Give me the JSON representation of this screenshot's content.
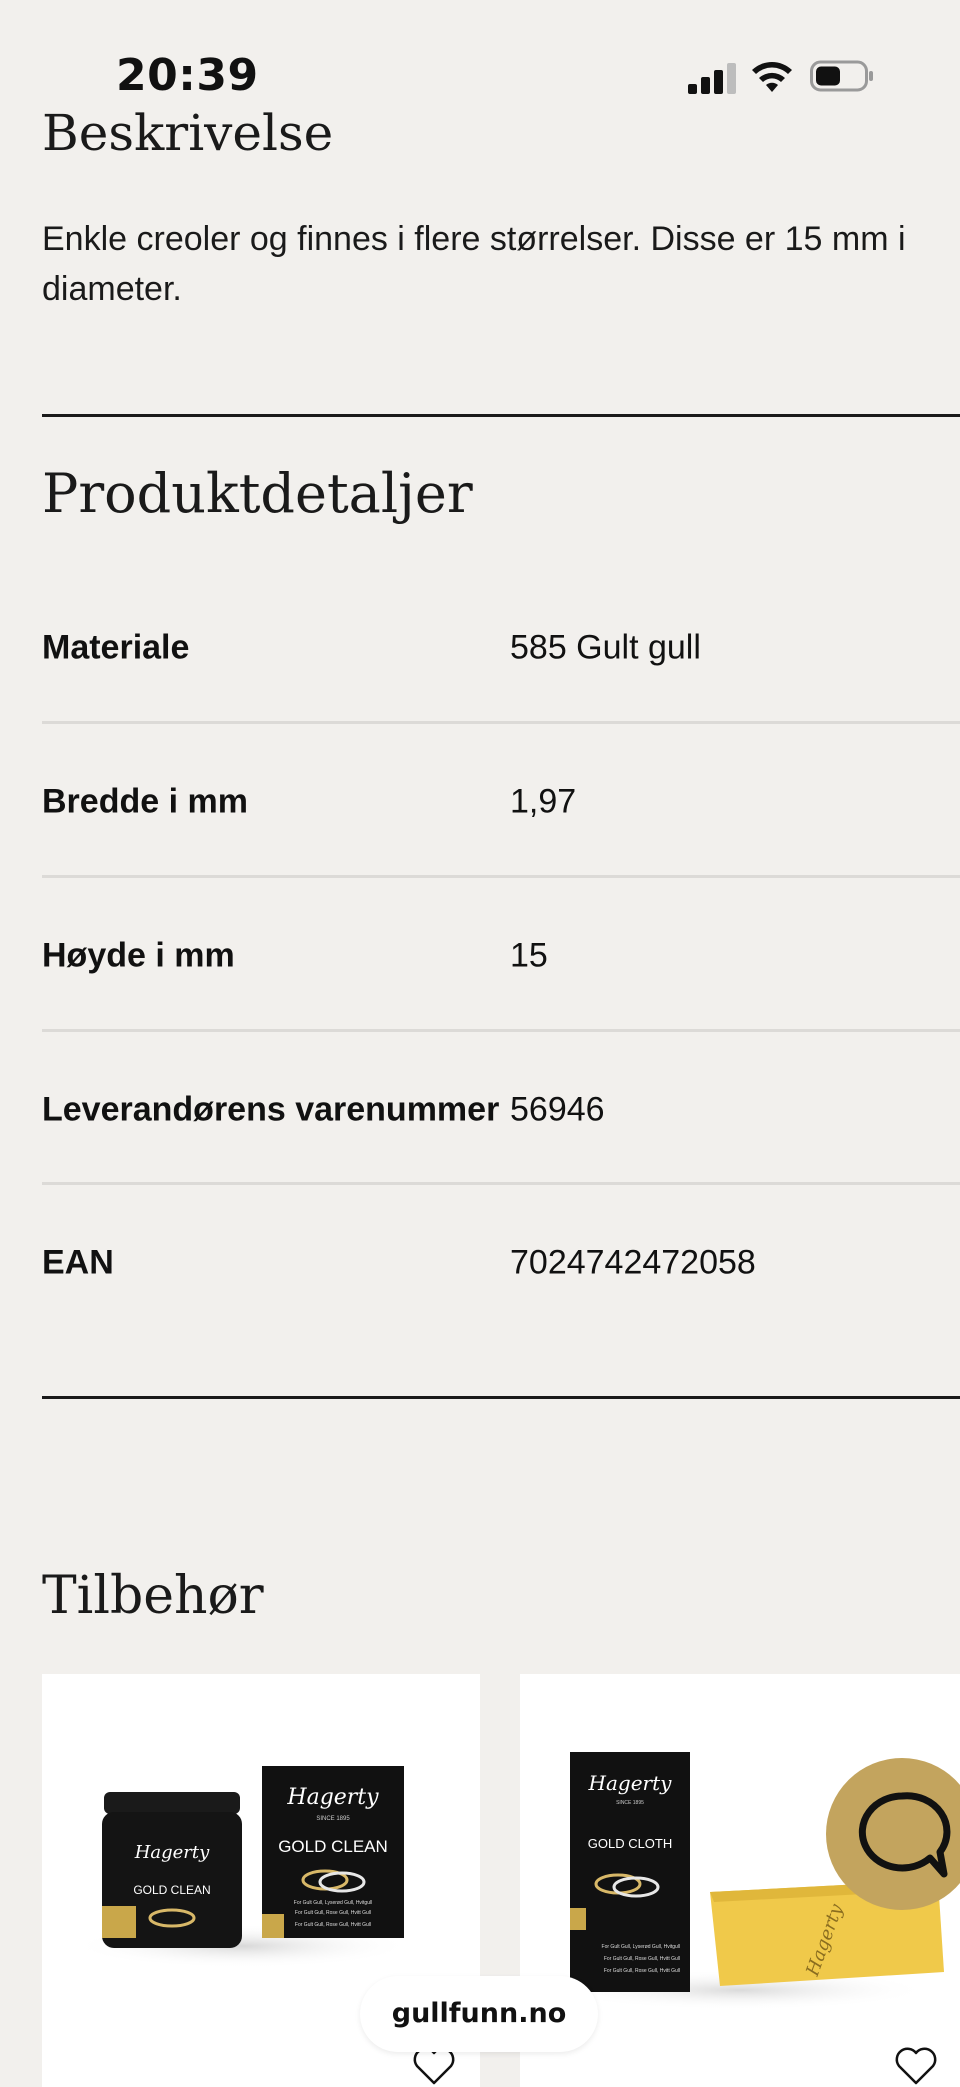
{
  "status_bar": {
    "time": "20:39",
    "icons": [
      "cellular-signal-icon",
      "wifi-icon",
      "battery-icon"
    ]
  },
  "description": {
    "title": "Beskrivelse",
    "text": "Enkle creoler og finnes i flere størrelser. Disse er 15 mm i diameter."
  },
  "details": {
    "title": "Produktdetaljer",
    "rows": [
      {
        "label": "Materiale",
        "value": "585 Gult gull"
      },
      {
        "label": "Bredde i mm",
        "value": "1,97"
      },
      {
        "label": "Høyde i mm",
        "value": "15"
      },
      {
        "label": "Leverandørens varenummer",
        "value": "56946"
      },
      {
        "label": "EAN",
        "value": "7024742472058"
      }
    ]
  },
  "accessories": {
    "title": "Tilbehør",
    "products": [
      {
        "brand": "Hagerty",
        "since": "SINCE 1895",
        "jar_label": "GOLD CLEAN",
        "box_label": "GOLD CLEAN",
        "fine_print": [
          "For Gult Gull, Lyserød Gull, Hvitgull",
          "For Gult Gull, Rose Gull, Hvitt Gull",
          "For Gult Gull, Rose Gull, Hvitt Gull"
        ],
        "icon": "heart-icon"
      },
      {
        "brand": "Hagerty",
        "since": "SINCE 1895",
        "box_label": "GOLD CLOTH",
        "fine_print": [
          "For Gult Gull, Lyserød Gull, Hvitgull",
          "For Gult Gull, Rose Gull, Hvitt Gull",
          "For Gult Gull, Rose Gull, Hvitt Gull"
        ],
        "icon": "heart-icon"
      }
    ]
  },
  "chat": {
    "icon": "chat-bubble-icon",
    "color": "#c3a45e"
  },
  "browser": {
    "url": "gullfunn.no"
  },
  "colors": {
    "background": "#f2f0ed",
    "accent": "#c3a45e",
    "text": "#111111"
  }
}
